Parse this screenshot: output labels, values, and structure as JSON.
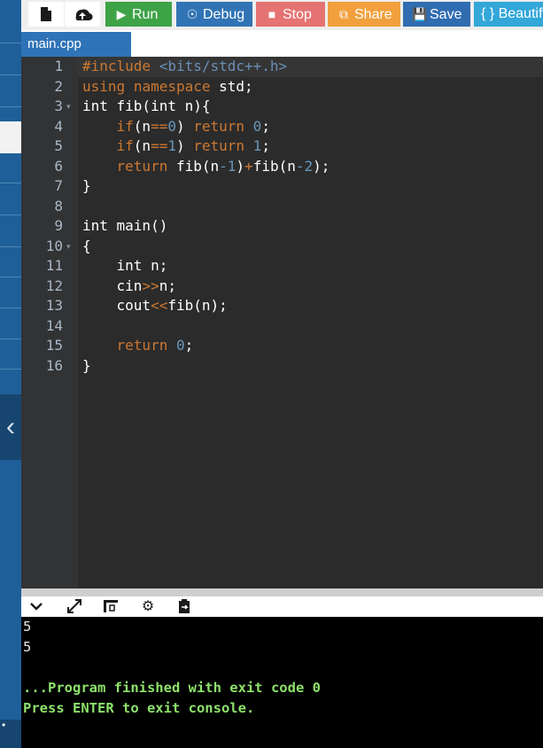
{
  "toolbar": {
    "new_file_icon": "file-icon",
    "upload_icon": "upload-icon",
    "run_label": "Run",
    "debug_label": "Debug",
    "stop_label": "Stop",
    "share_label": "Share",
    "save_label": "Save",
    "beautify_label": "{ } Beautify",
    "colors": {
      "run": "#3ea346",
      "debug": "#3174b5",
      "stop": "#e57373",
      "share": "#f2a03d",
      "save": "#2f6cb0",
      "beautify": "#32a7d8"
    }
  },
  "tabs": [
    {
      "label": "main.cpp"
    }
  ],
  "editor": {
    "line_numbers": [
      "1",
      "2",
      "3",
      "4",
      "5",
      "6",
      "7",
      "8",
      "9",
      "10",
      "11",
      "12",
      "13",
      "14",
      "15",
      "16"
    ],
    "lines": [
      "#include <bits/stdc++.h>",
      "using namespace std;",
      "int fib(int n){",
      "    if(n==0) return 0;",
      "    if(n==1) return 1;",
      "    return fib(n-1)+fib(n-2);",
      "}",
      "",
      "int main()",
      "{",
      "    int n;",
      "    cin>>n;",
      "    cout<<fib(n);",
      "",
      "    return 0;",
      "}"
    ]
  },
  "console_toolbar": {
    "icons": [
      "chevron-down-icon",
      "expand-icon",
      "layout-icon",
      "gear-icon",
      "clipboard-icon"
    ]
  },
  "console": {
    "lines": [
      "5",
      "5",
      "",
      "...Program finished with exit code 0",
      "Press ENTER to exit console."
    ]
  }
}
